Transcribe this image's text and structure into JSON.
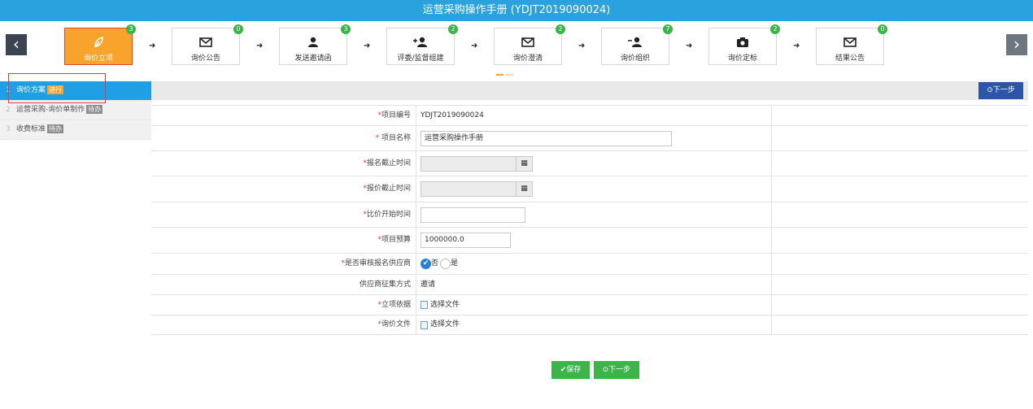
{
  "window": {
    "title": "运营采购操作手册 (YDJT2019090024)"
  },
  "nav": {
    "prev": "‹",
    "next": "›"
  },
  "steps": [
    {
      "label": "询价立项",
      "badge": "3",
      "icon": "leaf-icon"
    },
    {
      "label": "询价公告",
      "badge": "0",
      "icon": "envelope-icon"
    },
    {
      "label": "发送邀请函",
      "badge": "3",
      "icon": "user-icon"
    },
    {
      "label": "评委/监督组建",
      "badge": "2",
      "icon": "user-add-icon"
    },
    {
      "label": "询价澄清",
      "badge": "2",
      "icon": "envelope-icon"
    },
    {
      "label": "询价组织",
      "badge": "7",
      "icon": "user-remove-icon"
    },
    {
      "label": "询价定标",
      "badge": "2",
      "icon": "camera-icon"
    },
    {
      "label": "结果公告",
      "badge": "0",
      "icon": "envelope-icon"
    }
  ],
  "sidebar": {
    "items": [
      {
        "num": "1",
        "label": "询价方案",
        "tag": "进行"
      },
      {
        "num": "2",
        "label": "运营采购-询价单制作",
        "tag": "待办"
      },
      {
        "num": "3",
        "label": "收费标准",
        "tag": "待办"
      }
    ]
  },
  "toolbar": {
    "next_label": "⊙下一步"
  },
  "form": {
    "fields": [
      {
        "label": "项目编号",
        "value": "YDJT2019090024"
      },
      {
        "label": "项目名称",
        "value": "运营采购操作手册"
      },
      {
        "label": "报名截止时间",
        "value": ""
      },
      {
        "label": "报价截止时间",
        "value": ""
      },
      {
        "label": "比价开始时间",
        "value": ""
      },
      {
        "label": "项目预算",
        "value": "1000000.0"
      },
      {
        "label": "是否审核报名供应商",
        "options": [
          "否",
          "是"
        ],
        "selected": "否"
      },
      {
        "label": "供应商征集方式",
        "value": "邀请"
      },
      {
        "label": "立项依据",
        "value": "选择文件"
      },
      {
        "label": "询价文件",
        "value": "选择文件"
      }
    ]
  },
  "footer": {
    "save_label": "✔保存",
    "next_label": "⊙下一步"
  },
  "colors": {
    "header": "#29a2de",
    "active_step": "#f7a32c",
    "badge": "#39b54a",
    "sidebar_active": "#1e9fe6",
    "primary_button": "#2c55a7",
    "save_button": "#3cb44a"
  }
}
